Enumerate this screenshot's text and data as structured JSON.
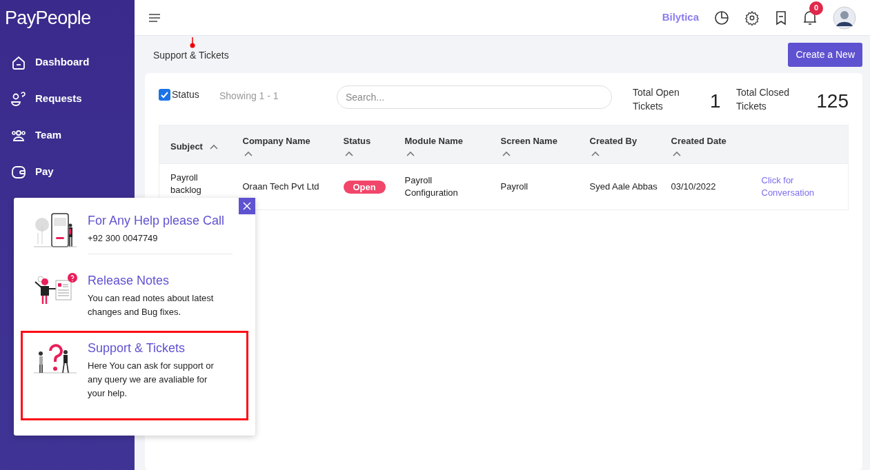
{
  "brand": {
    "logo": "PayPeople"
  },
  "sidebar": {
    "items": [
      {
        "label": "Dashboard",
        "kind": "home"
      },
      {
        "label": "Requests",
        "kind": "requests"
      },
      {
        "label": "Team",
        "kind": "team"
      },
      {
        "label": "Pay",
        "kind": "pay"
      }
    ]
  },
  "header": {
    "company": "Bilytica",
    "notifications": "0"
  },
  "page": {
    "title": "Support & Tickets",
    "create_button": "Create a New"
  },
  "toolbar": {
    "status_checkbox": {
      "label": "Status",
      "checked": true
    },
    "showing": "Showing 1 - 1",
    "search": {
      "placeholder": "Search..."
    },
    "total_open": {
      "label": "Total Open Tickets",
      "value": "1"
    },
    "total_closed": {
      "label": "Total Closed Tickets",
      "value": "125"
    }
  },
  "table": {
    "columns": [
      "Subject",
      "Company Name",
      "Status",
      "Module Name",
      "Screen Name",
      "Created By",
      "Created Date"
    ],
    "rows": [
      {
        "subject": "Payroll backlog",
        "company": "Oraan Tech Pvt Ltd",
        "status": "Open",
        "module": "Payroll Configuration",
        "screen": "Payroll",
        "created_by": "Syed Aale Abbas",
        "created_date": "03/10/2022",
        "action": "Click for Conversation"
      }
    ]
  },
  "help_popup": {
    "items": [
      {
        "kind": "phone",
        "title": "For Any Help please Call",
        "text": "+92 300 0047749",
        "selected": false
      },
      {
        "kind": "notes",
        "title": "Release Notes",
        "text": "You can read notes about latest changes and Bug fixes.",
        "selected": false
      },
      {
        "kind": "question",
        "title": "Support & Tickets",
        "text": "Here You can ask for support or any query we are avaliable for your help.",
        "selected": true
      }
    ]
  }
}
